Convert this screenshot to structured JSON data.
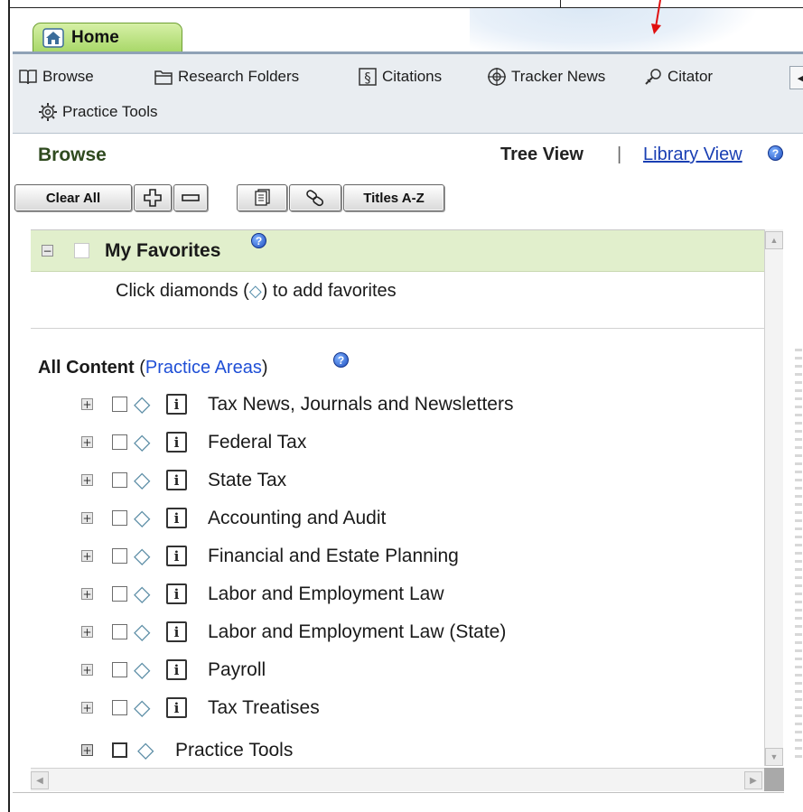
{
  "tab": {
    "label": "Home"
  },
  "toolbar": {
    "items": [
      {
        "label": "Browse",
        "icon": "book-icon"
      },
      {
        "label": "Research Folders",
        "icon": "folder-icon"
      },
      {
        "label": "Citations",
        "icon": "citations-icon"
      },
      {
        "label": "Tracker News",
        "icon": "tracker-icon"
      },
      {
        "label": "Citator",
        "icon": "citator-icon"
      },
      {
        "label": "Practice Tools",
        "icon": "gear-icon"
      }
    ],
    "scroll_icon": "◀"
  },
  "browse": {
    "title": "Browse",
    "tree_view": "Tree View",
    "separator": "|",
    "library_view": "Library View",
    "help": "?"
  },
  "buttons": {
    "clear_all": "Clear All",
    "expand": "+",
    "collapse": "−",
    "titles": "Titles A-Z"
  },
  "favorites": {
    "title": "My Favorites",
    "hint_before": "Click diamonds (",
    "hint_diamond": "◇",
    "hint_after": ") to add favorites"
  },
  "all_content": {
    "label": "All Content",
    "paren_open": " (",
    "link": "Practice Areas",
    "paren_close": ")"
  },
  "tree": {
    "items": [
      "Tax News, Journals and Newsletters",
      "Federal Tax",
      "State Tax",
      "Accounting and Audit",
      "Financial and Estate Planning",
      "Labor and Employment Law",
      "Labor and Employment Law (State)",
      "Payroll",
      "Tax Treatises"
    ],
    "practice_tools": "Practice Tools",
    "expander_symbol": "+",
    "collapse_symbol": "−",
    "diamond_symbol": "◇",
    "info_symbol": "i"
  },
  "colors": {
    "tab_green": "#a9d86a",
    "favorites_bg": "#e1efcc",
    "link_blue": "#1a3fb3",
    "toolbar_bg": "#e9edf1",
    "annotation_arrow": "#e01010"
  }
}
